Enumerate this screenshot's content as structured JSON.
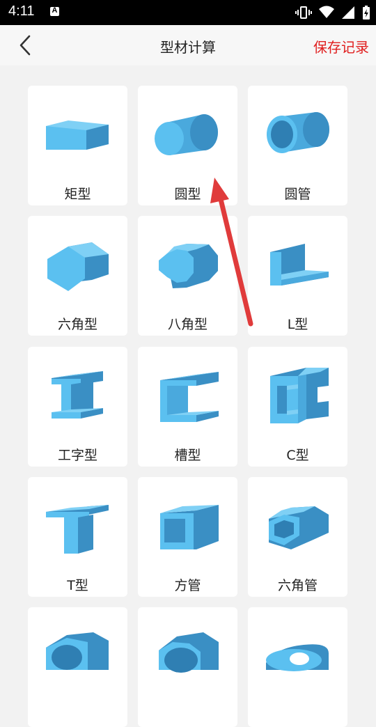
{
  "status": {
    "time": "4:11",
    "notif_letter": "A"
  },
  "header": {
    "title": "型材计算",
    "save_label": "保存记录"
  },
  "items": [
    {
      "label": "矩型",
      "icon": "rectangle-bar-icon"
    },
    {
      "label": "圆型",
      "icon": "round-bar-icon"
    },
    {
      "label": "圆管",
      "icon": "round-tube-icon"
    },
    {
      "label": "六角型",
      "icon": "hexagon-bar-icon"
    },
    {
      "label": "八角型",
      "icon": "octagon-bar-icon"
    },
    {
      "label": "L型",
      "icon": "l-angle-icon"
    },
    {
      "label": "工字型",
      "icon": "i-beam-icon"
    },
    {
      "label": "槽型",
      "icon": "channel-icon"
    },
    {
      "label": "C型",
      "icon": "c-channel-icon"
    },
    {
      "label": "T型",
      "icon": "t-bar-icon"
    },
    {
      "label": "方管",
      "icon": "square-tube-icon"
    },
    {
      "label": "六角管",
      "icon": "hexagon-tube-icon"
    },
    {
      "label": "",
      "icon": "shape-icon"
    },
    {
      "label": "",
      "icon": "shape-icon"
    },
    {
      "label": "",
      "icon": "shape-icon"
    }
  ],
  "colors": {
    "shape_fill": "#5bc0f0",
    "shape_dark": "#3a8fc4",
    "accent_red": "#e01e1e",
    "arrow_red": "#e03b3b"
  }
}
